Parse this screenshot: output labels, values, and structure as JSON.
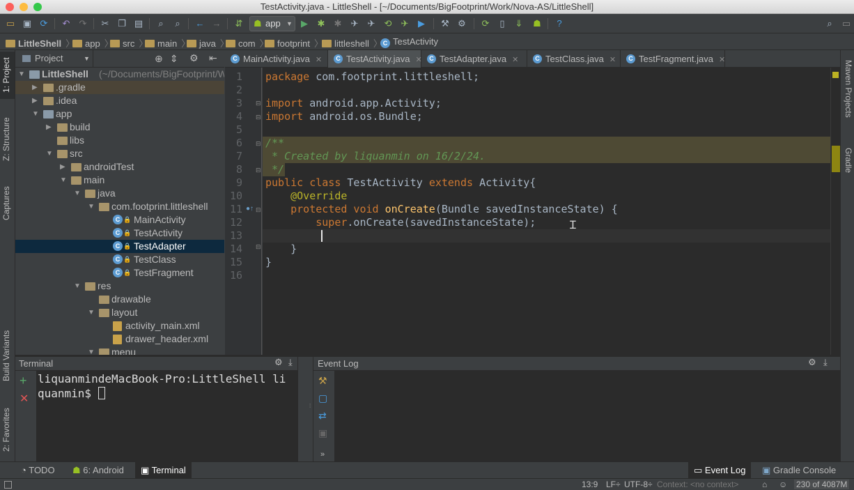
{
  "window": {
    "title": "TestActivity.java - LittleShell - [~/Documents/BigFootprint/Work/Nova-AS/LittleShell]"
  },
  "toolbar": {
    "run_config": "app"
  },
  "breadcrumbs": [
    "LittleShell",
    "app",
    "src",
    "main",
    "java",
    "com",
    "footprint",
    "littleshell",
    "TestActivity"
  ],
  "left_stripe": {
    "project": "1: Project",
    "structure": "Z: Structure",
    "captures": "Captures",
    "build_variants": "Build Variants",
    "favorites": "2: Favorites"
  },
  "right_stripe": {
    "maven": "Maven Projects",
    "gradle": "Gradle"
  },
  "project_panel": {
    "view_label": "Project",
    "tree": [
      {
        "label": "LittleShell",
        "hint": "(~/Documents/BigFootprint/Work/Nova-AS/LittleShell)",
        "kind": "module",
        "level": 0,
        "expanded": true
      },
      {
        "label": ".gradle",
        "kind": "folder",
        "level": 1,
        "expanded": false,
        "highlight": true
      },
      {
        "label": ".idea",
        "kind": "folder",
        "level": 1,
        "expanded": false
      },
      {
        "label": "app",
        "kind": "module",
        "level": 1,
        "expanded": true
      },
      {
        "label": "build",
        "kind": "folder",
        "level": 2,
        "expanded": false
      },
      {
        "label": "libs",
        "kind": "folder",
        "level": 2,
        "leaf": true
      },
      {
        "label": "src",
        "kind": "folder",
        "level": 2,
        "expanded": true
      },
      {
        "label": "androidTest",
        "kind": "folder",
        "level": 3,
        "expanded": false
      },
      {
        "label": "main",
        "kind": "folder",
        "level": 3,
        "expanded": true
      },
      {
        "label": "java",
        "kind": "folder",
        "level": 4,
        "expanded": true
      },
      {
        "label": "com.footprint.littleshell",
        "kind": "folder",
        "level": 5,
        "expanded": true
      },
      {
        "label": "MainActivity",
        "kind": "class",
        "level": 6
      },
      {
        "label": "TestActivity",
        "kind": "class",
        "level": 6
      },
      {
        "label": "TestAdapter",
        "kind": "class",
        "level": 6,
        "selected": true
      },
      {
        "label": "TestClass",
        "kind": "class",
        "level": 6
      },
      {
        "label": "TestFragment",
        "kind": "class",
        "level": 6
      },
      {
        "label": "res",
        "kind": "folder",
        "level": 4,
        "expanded": true
      },
      {
        "label": "drawable",
        "kind": "folder",
        "level": 5,
        "leaf": true
      },
      {
        "label": "layout",
        "kind": "folder",
        "level": 5,
        "expanded": true
      },
      {
        "label": "activity_main.xml",
        "kind": "xml",
        "level": 6
      },
      {
        "label": "drawer_header.xml",
        "kind": "xml",
        "level": 6
      },
      {
        "label": "menu",
        "kind": "folder",
        "level": 5,
        "expanded": true
      }
    ]
  },
  "editor_tabs": [
    {
      "label": "MainActivity.java",
      "active": false
    },
    {
      "label": "TestActivity.java",
      "active": true
    },
    {
      "label": "TestAdapter.java",
      "active": false
    },
    {
      "label": "TestClass.java",
      "active": false
    },
    {
      "label": "TestFragment.java",
      "active": false
    }
  ],
  "editor": {
    "line_numbers": [
      "1",
      "2",
      "3",
      "4",
      "5",
      "6",
      "7",
      "8",
      "9",
      "10",
      "11",
      "12",
      "13",
      "14",
      "15",
      "16"
    ],
    "lines": [
      [
        {
          "t": "package ",
          "c": "kw"
        },
        {
          "t": "com.footprint.littleshell;",
          "c": ""
        }
      ],
      [],
      [
        {
          "t": "import ",
          "c": "kw"
        },
        {
          "t": "android.app.Activity;",
          "c": ""
        }
      ],
      [
        {
          "t": "import ",
          "c": "kw"
        },
        {
          "t": "android.os.Bundle;",
          "c": ""
        }
      ],
      [],
      [
        {
          "t": "/**",
          "c": "cm"
        }
      ],
      [
        {
          "t": " * Created by liquanmin on 16/2/24.",
          "c": "cm"
        }
      ],
      [
        {
          "t": " */",
          "c": "cm"
        }
      ],
      [
        {
          "t": "public class ",
          "c": "kw"
        },
        {
          "t": "TestActivity ",
          "c": ""
        },
        {
          "t": "extends ",
          "c": "kw"
        },
        {
          "t": "Activity{",
          "c": ""
        }
      ],
      [
        {
          "t": "    @Override",
          "c": "ann"
        }
      ],
      [
        {
          "t": "    protected void ",
          "c": "kw"
        },
        {
          "t": "onCreate",
          "c": "fn"
        },
        {
          "t": "(Bundle savedInstanceState) {",
          "c": ""
        }
      ],
      [
        {
          "t": "        super",
          "c": "kw"
        },
        {
          "t": ".onCreate(savedInstanceState);",
          "c": ""
        }
      ],
      [
        {
          "t": "        ",
          "c": ""
        }
      ],
      [
        {
          "t": "    }",
          "c": ""
        }
      ],
      [
        {
          "t": "}",
          "c": ""
        }
      ],
      []
    ]
  },
  "terminal": {
    "title": "Terminal",
    "line1": "liquanmindeMacBook-Pro:LittleShell li",
    "line2": "quanmin$ "
  },
  "event_log": {
    "title": "Event Log"
  },
  "tool_windows": {
    "todo": "TODO",
    "android": "6: Android",
    "terminal": "Terminal",
    "event_log": "Event Log",
    "gradle_console": "Gradle Console"
  },
  "status": {
    "position": "13:9",
    "line_sep": "LF÷",
    "encoding": "UTF-8÷",
    "context": "Context: <no context>",
    "memory": "230 of 4087M"
  },
  "colors": {
    "selection": "#0d293e",
    "keyword": "#cc7832",
    "annotation": "#bbb529",
    "method": "#ffc66d",
    "comment": "#629755"
  }
}
